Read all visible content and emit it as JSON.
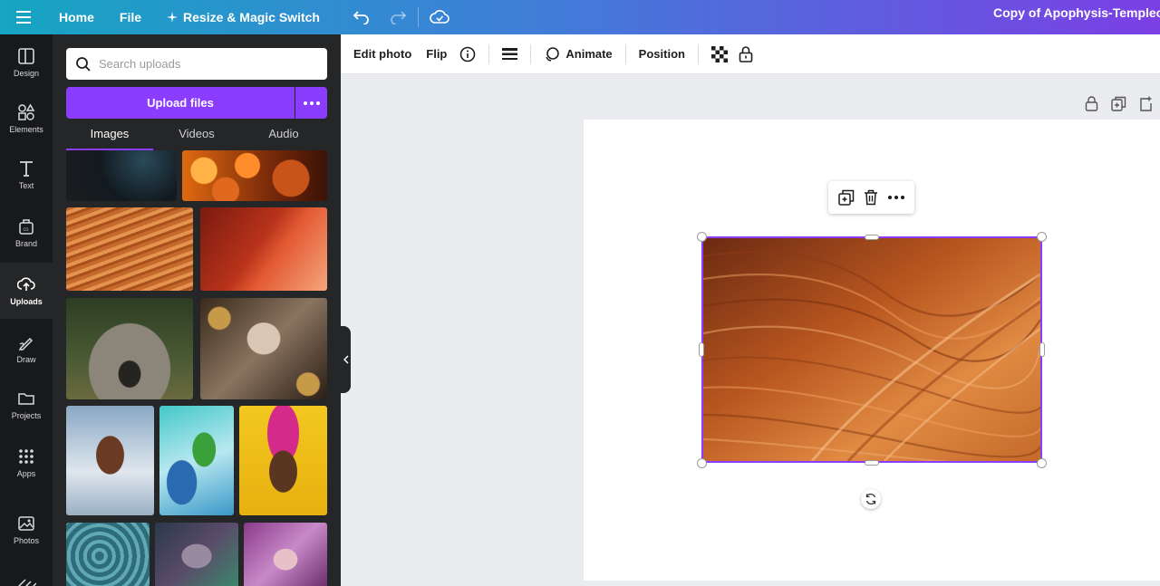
{
  "topbar": {
    "home_label": "Home",
    "file_label": "File",
    "resize_label": "Resize & Magic Switch",
    "doc_title": "Copy of Apophysis-TempleofRo"
  },
  "rail": {
    "items": [
      {
        "label": "Design",
        "icon": "layout-icon"
      },
      {
        "label": "Elements",
        "icon": "shapes-icon"
      },
      {
        "label": "Text",
        "icon": "text-icon"
      },
      {
        "label": "Brand",
        "icon": "brand-icon"
      },
      {
        "label": "Uploads",
        "icon": "upload-cloud-icon"
      },
      {
        "label": "Draw",
        "icon": "pen-icon"
      },
      {
        "label": "Projects",
        "icon": "folder-icon"
      },
      {
        "label": "Apps",
        "icon": "apps-grid-icon"
      },
      {
        "label": "Photos",
        "icon": "image-icon"
      }
    ],
    "active": "Uploads"
  },
  "panel": {
    "search_placeholder": "Search uploads",
    "upload_label": "Upload files",
    "tabs": [
      {
        "label": "Images",
        "active": true
      },
      {
        "label": "Videos",
        "active": false
      },
      {
        "label": "Audio",
        "active": false
      }
    ]
  },
  "context_toolbar": {
    "edit_photo": "Edit photo",
    "flip": "Flip",
    "animate": "Animate",
    "position": "Position"
  },
  "colors": {
    "accent": "#8b3dff",
    "topbar_start": "#16a5c2",
    "topbar_end": "#7b3fe4",
    "panel_bg": "#252627",
    "rail_bg": "#18191b"
  }
}
